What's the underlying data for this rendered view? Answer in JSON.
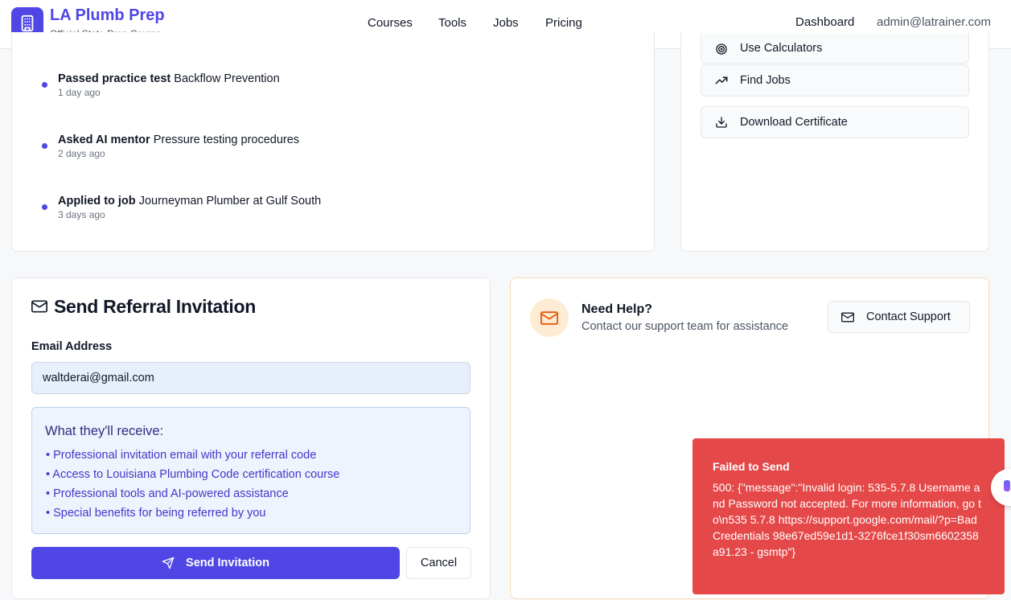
{
  "header": {
    "brand_title": "LA Plumb Prep",
    "brand_subtitle": "Official State Prep Course",
    "nav": [
      "Courses",
      "Tools",
      "Jobs",
      "Pricing"
    ],
    "dashboard": "Dashboard",
    "user_email": "admin@latrainer.com"
  },
  "activity": [
    {
      "action": "Passed practice test",
      "detail": "Backflow Prevention",
      "time": "1 day ago"
    },
    {
      "action": "Asked AI mentor",
      "detail": "Pressure testing procedures",
      "time": "2 days ago"
    },
    {
      "action": "Applied to job",
      "detail": "Journeyman Plumber at Gulf South",
      "time": "3 days ago"
    }
  ],
  "quick_actions": {
    "use_calculators": "Use Calculators",
    "find_jobs": "Find Jobs",
    "download_certificate": "Download Certificate"
  },
  "referral": {
    "title": "Send Referral Invitation",
    "email_label": "Email Address",
    "email_value": "waltderai@gmail.com",
    "receive_title": "What they'll receive:",
    "benefits": [
      "• Professional invitation email with your referral code",
      "• Access to Louisiana Plumbing Code certification course",
      "• Professional tools and AI-powered assistance",
      "• Special benefits for being referred by you"
    ],
    "send_label": "Send Invitation",
    "cancel_label": "Cancel"
  },
  "help": {
    "title": "Need Help?",
    "subtitle": "Contact our support team for assistance",
    "contact_label": "Contact Support"
  },
  "toast": {
    "title": "Failed to Send",
    "message": "500: {\"message\":\"Invalid login: 535-5.7.8 Username and Password not accepted. For more information, go to\\n535 5.7.8 https://support.google.com/mail/?p=BadCredentials 98e67ed59e1d1-3276fce1f30sm6602358a91.23 - gsmtp\"}"
  },
  "colors": {
    "primary": "#4f46e5",
    "toast_bg": "#e54848",
    "info_bg": "#eef3fd",
    "help_icon_bg": "#fdebd3"
  }
}
